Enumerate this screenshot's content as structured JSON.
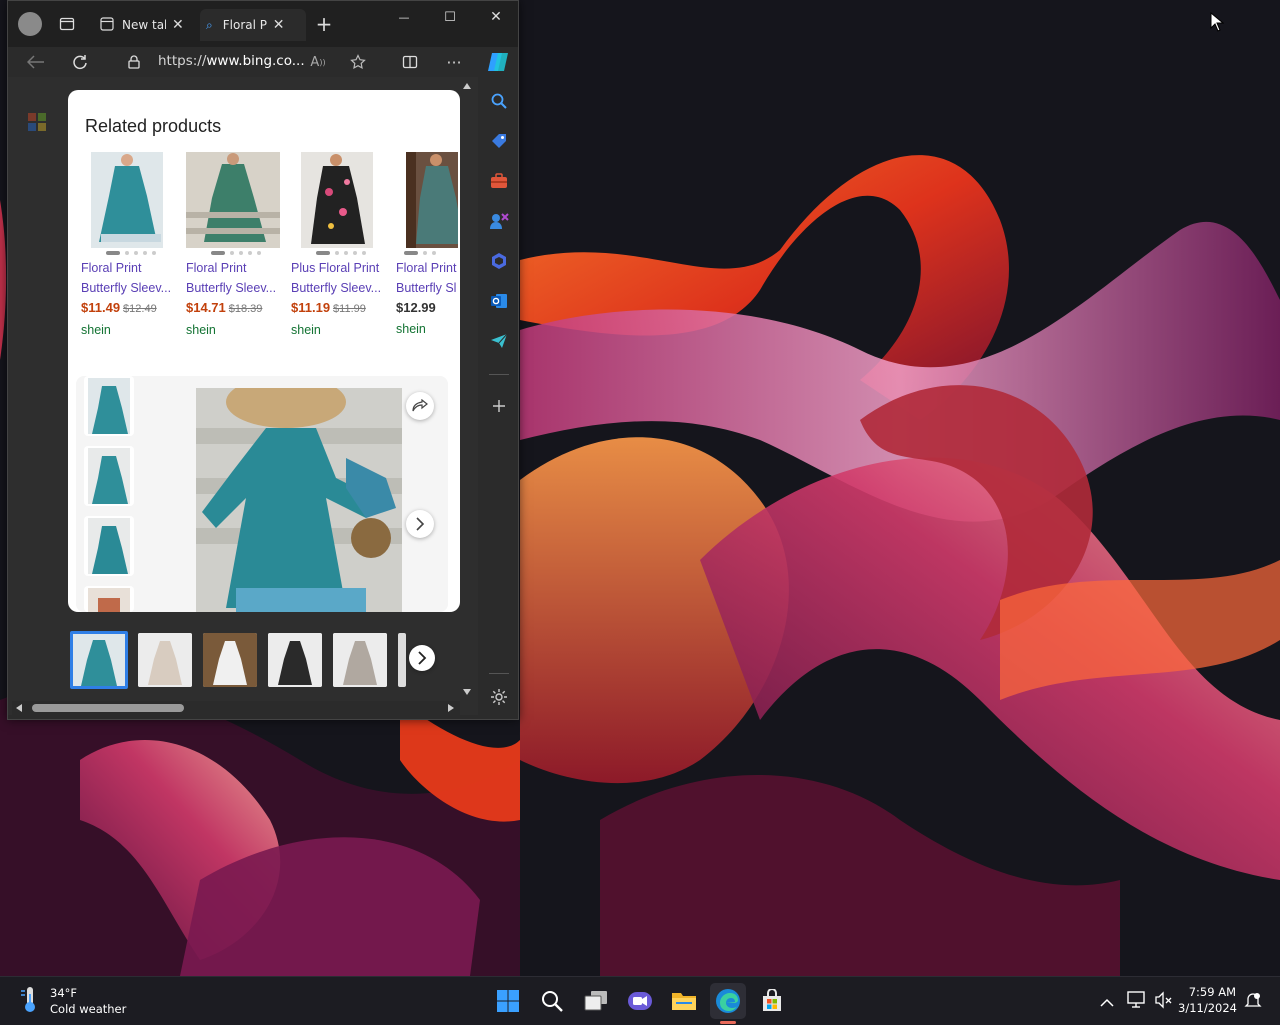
{
  "browser": {
    "tabs": [
      {
        "title": "New tab",
        "close": "✕"
      },
      {
        "title": "Floral Print",
        "close": "✕"
      }
    ],
    "new_tab_label": "+",
    "window_controls": {
      "minimize": "—",
      "maximize": "☐",
      "close": "✕"
    },
    "address": {
      "scheme": "https://",
      "host": "www.bing.co..."
    },
    "more_label": "···"
  },
  "related": {
    "title": "Related products",
    "products": [
      {
        "name1": "Floral Print",
        "name2": "Butterfly Sleev...",
        "price": "$11.49",
        "old_price": "$12.49",
        "seller": "shein",
        "color": "#2f8f9a"
      },
      {
        "name1": "Floral Print",
        "name2": "Butterfly Sleev...",
        "price": "$14.71",
        "old_price": "$18.39",
        "seller": "shein",
        "color": "#3d7f6a"
      },
      {
        "name1": "Plus Floral Print",
        "name2": "Butterfly Sleev...",
        "price": "$11.19",
        "old_price": "$11.99",
        "seller": "shein",
        "color": "#2a2a2a"
      },
      {
        "name1": "Floral Print",
        "name2": "Butterfly Sl",
        "price": "$12.99",
        "old_price": "",
        "seller": "shein",
        "color": "#4a7a78"
      }
    ]
  },
  "gallery": {
    "share_icon": "share-icon",
    "next_icon": "chevron-right-icon"
  },
  "taskbar": {
    "weather_temp": "34°F",
    "weather_desc": "Cold weather",
    "time": "7:59 AM",
    "date": "3/11/2024"
  },
  "colors": {
    "accent": "#2f7fe6",
    "price_red": "#c2410c",
    "seller_green": "#137333",
    "link_purple": "#5a3fb5"
  }
}
